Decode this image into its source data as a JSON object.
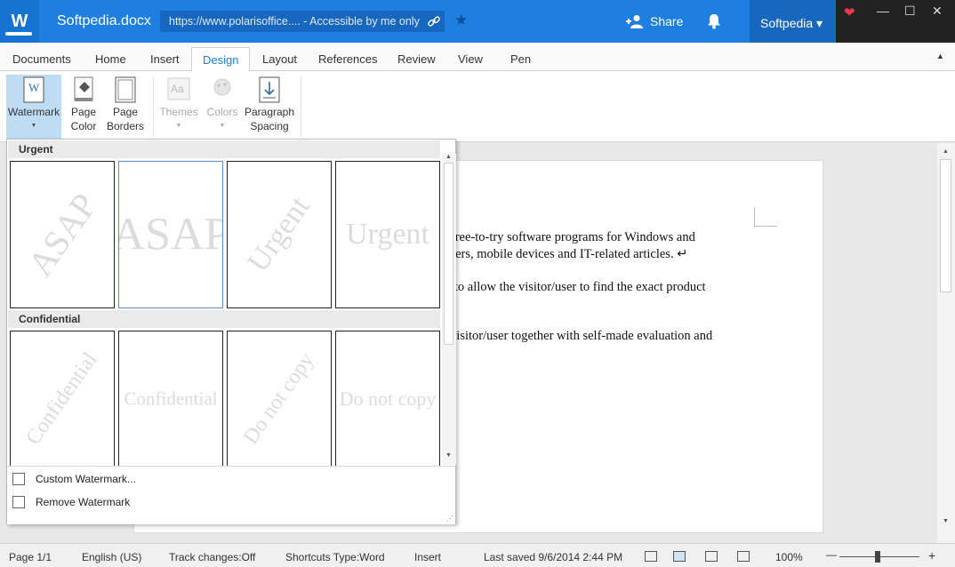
{
  "app": {
    "logo_letter": "W",
    "doc_title": "Softpedia.docx",
    "url_text": "https://www.polarisoffice.... - Accessible by me only",
    "share_label": "Share",
    "account_label": "Softpedia ▾"
  },
  "window": {
    "minimize": "—",
    "maximize": "☐",
    "close": "✕",
    "heart": "❤"
  },
  "tabs": [
    {
      "label": "Documents"
    },
    {
      "label": "Home"
    },
    {
      "label": "Insert"
    },
    {
      "label": "Design"
    },
    {
      "label": "Layout"
    },
    {
      "label": "References"
    },
    {
      "label": "Review"
    },
    {
      "label": "View"
    },
    {
      "label": "Pen"
    }
  ],
  "active_tab": "Design",
  "ribbon": {
    "watermark": "Watermark",
    "page_color_1": "Page",
    "page_color_2": "Color",
    "page_borders_1": "Page",
    "page_borders_2": "Borders",
    "themes": "Themes",
    "colors": "Colors",
    "paragraph_spacing_1": "Paragraph",
    "paragraph_spacing_2": "Spacing",
    "collapse": "▲"
  },
  "watermark_gallery": {
    "sections": [
      {
        "title": "Urgent",
        "items": [
          {
            "text": "ASAP"
          },
          {
            "text": "ASAP"
          },
          {
            "text": "Urgent"
          },
          {
            "text": "Urgent"
          }
        ]
      },
      {
        "title": "Confidential",
        "items": [
          {
            "text": "Confidential"
          },
          {
            "text": "Confidential"
          },
          {
            "text": "Do not copy"
          },
          {
            "text": "Do not copy"
          }
        ]
      }
    ],
    "menu": {
      "custom": "Custom Watermark...",
      "remove": "Remove Watermark"
    },
    "scroll_up": "▲",
    "scroll_down": "▼"
  },
  "document": {
    "lines": [
      "d free-to-try software programs for Windows and",
      "rivers, mobile devices and IT-related articles. ↵",
      "er to allow the visitor/user to find the exact product",
      "e visitor/user together with self-made evaluation and"
    ]
  },
  "status": {
    "page": "Page 1/1",
    "language": "English (US)",
    "track_changes": "Track changes:Off",
    "shortcuts": "Shortcuts Type:Word",
    "mode": "Insert",
    "last_saved": "Last saved 9/6/2014 2:44 PM",
    "zoom": "100%",
    "zoom_out": "—",
    "zoom_in": "+"
  },
  "colors": {
    "title_bar": "#1e7fe0",
    "active_tab_text": "#1e7fe0",
    "selected_button": "#bfdcf5"
  }
}
